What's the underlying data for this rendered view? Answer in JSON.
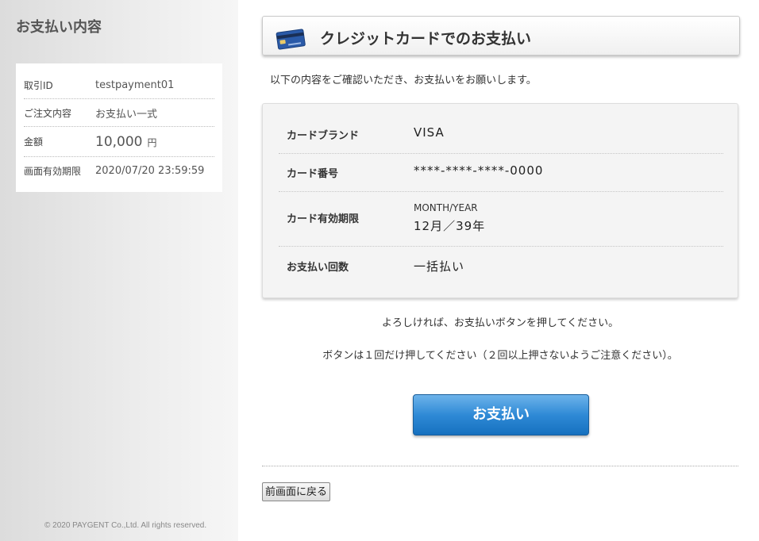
{
  "sidebar": {
    "title": "お支払い内容",
    "rows": [
      {
        "label": "取引ID",
        "value": "testpayment01"
      },
      {
        "label": "ご注文内容",
        "value": "お支払い一式"
      },
      {
        "label": "金額",
        "value": "10,000",
        "unit": "円"
      },
      {
        "label": "画面有効期限",
        "value": "2020/07/20 23:59:59"
      }
    ],
    "copyright": "© 2020 PAYGENT Co.,Ltd. All rights reserved."
  },
  "header": {
    "title": "クレジットカードでのお支払い",
    "icon": "credit-card-icon"
  },
  "intro": "以下の内容をご確認いただき、お支払いをお願いします。",
  "details": {
    "brand": {
      "label": "カードブランド",
      "value": "VISA"
    },
    "number": {
      "label": "カード番号",
      "value": "****-****-****-0000"
    },
    "expiry": {
      "label": "カード有効期限",
      "sublabel": "MONTH/YEAR",
      "value": "12月／39年"
    },
    "installments": {
      "label": "お支払い回数",
      "value": "一括払い"
    }
  },
  "notice1": "よろしければ、お支払いボタンを押してください。",
  "notice2": "ボタンは１回だけ押してください（２回以上押さないようご注意ください）。",
  "pay_button": "お支払い",
  "back_button": "前画面に戻る",
  "colors": {
    "button": "#2f8ad6",
    "panel": "#f4f4f4"
  }
}
